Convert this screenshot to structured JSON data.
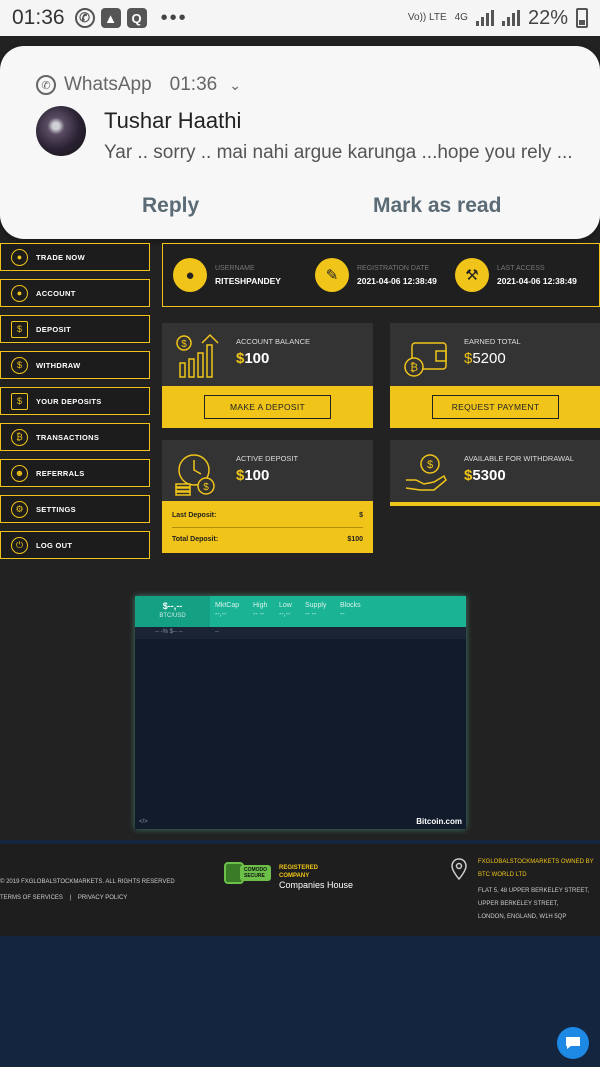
{
  "status_bar": {
    "time": "01:36",
    "battery": "22%",
    "network": "4G",
    "volte": "Vo)) LTE",
    "overflow": "•••"
  },
  "notification": {
    "app": "WhatsApp",
    "time": "01:36",
    "sender": "Tushar Haathi",
    "message": "Yar .. sorry .. mai nahi argue karunga ...hope you rely ...",
    "reply_label": "Reply",
    "mark_read_label": "Mark as read"
  },
  "sidebar": {
    "items": [
      {
        "label": "TRADE NOW",
        "icon": "user-icon"
      },
      {
        "label": "ACCOUNT",
        "icon": "account-icon"
      },
      {
        "label": "DEPOSIT",
        "icon": "deposit-icon"
      },
      {
        "label": "WITHDRAW",
        "icon": "withdraw-icon"
      },
      {
        "label": "YOUR DEPOSITS",
        "icon": "deposits-icon"
      },
      {
        "label": "TRANSACTIONS",
        "icon": "bitcoin-icon"
      },
      {
        "label": "REFERRALS",
        "icon": "referrals-icon"
      },
      {
        "label": "SETTINGS",
        "icon": "gear-icon"
      },
      {
        "label": "LOG OUT",
        "icon": "logout-icon"
      }
    ]
  },
  "info": {
    "username_caption": "USERNAME",
    "username": "RITESHPANDEY",
    "registered_caption": "REGISTRATION DATE",
    "registered": "2021-04-06 12:38:49",
    "last_access_caption": "LAST ACCESS",
    "last_access": "2021-04-06 12:38:49"
  },
  "cards": {
    "balance": {
      "caption": "ACCOUNT BALANCE",
      "currency": "$",
      "amount": "100",
      "button": "MAKE A DEPOSIT"
    },
    "earned": {
      "caption": "EARNED TOTAL",
      "currency": "$",
      "amount": "5200",
      "button": "REQUEST PAYMENT"
    },
    "active": {
      "caption": "ACTIVE DEPOSIT",
      "currency": "$",
      "amount": "100",
      "last_label": "Last Deposit:",
      "last_value": "$",
      "total_label": "Total Deposit:",
      "total_value": "$100"
    },
    "available": {
      "caption": "AVAILABLE FOR WITHDRAWAL",
      "currency": "$",
      "amount": "5300"
    }
  },
  "widget": {
    "price": "$--,--",
    "pair": "BTC/USD",
    "columns": [
      {
        "label": "MktCap",
        "value": "--,--"
      },
      {
        "label": "High",
        "value": "-- --"
      },
      {
        "label": "Low",
        "value": "--,--"
      },
      {
        "label": "Supply",
        "value": "-- --"
      },
      {
        "label": "Blocks",
        "value": "--"
      }
    ],
    "change": "-- -% $-- --",
    "change2": "--",
    "embed": "</>",
    "brand": "Bitcoin.com"
  },
  "footer": {
    "copyright": "© 2019 FXGLOBALSTOCKMARKETS. ALL RIGHTS RESERVED",
    "terms": "TERMS OF SERVICES",
    "separator": "|",
    "privacy": "PRIVACY POLICY",
    "ssl_top": "COMODO",
    "ssl_bottom": "SECURE",
    "registered_line1": "REGISTERED",
    "registered_line2": "COMPANY",
    "companies_house": "Companies House",
    "owner_line1": "FXGLOBALSTOCKMARKETS OWNED BY",
    "owner_line2": "BTC WORLD LTD",
    "address1": "FLAT 5, 48 UPPER BERKELEY STREET,",
    "address2": "UPPER BERKELEY STREET,",
    "address3": "LONDON, ENGLAND, W1H 5QP"
  },
  "colors": {
    "accent": "#f0c419",
    "background": "#222222",
    "card": "#333333",
    "widget_header": "#1ab394",
    "footer_bottom": "#14263f",
    "chat_button": "#1e88e5"
  }
}
